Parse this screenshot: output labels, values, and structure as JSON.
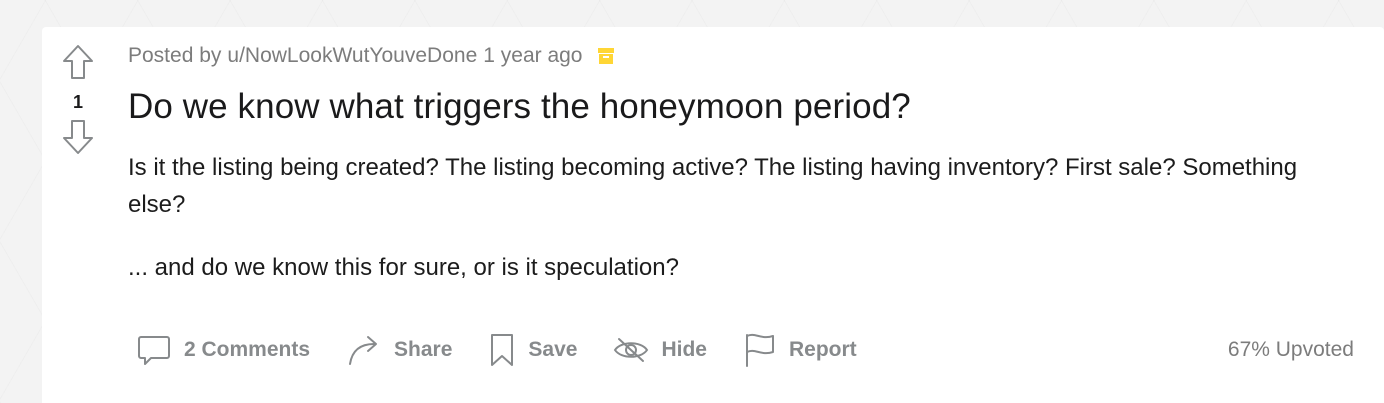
{
  "post": {
    "posted_by_prefix": "Posted by",
    "author": "u/NowLookWutYouveDone",
    "time": "1 year ago",
    "archive_icon": "archive-icon",
    "vote_count": "1",
    "title": "Do we know what triggers the honeymoon period?",
    "body": [
      "Is it the listing being created? The listing becoming active? The listing having inventory? First sale? Something else?",
      "... and do we know this for sure, or is it speculation?"
    ],
    "upvoted": "67% Upvoted"
  },
  "actions": {
    "comments_label": "2 Comments",
    "share_label": "Share",
    "save_label": "Save",
    "hide_label": "Hide",
    "report_label": "Report"
  },
  "icons": {
    "upvote": "upvote-arrow-icon",
    "downvote": "downvote-arrow-icon",
    "comments": "comment-bubble-icon",
    "share": "share-arrow-icon",
    "save": "bookmark-icon",
    "hide": "eye-slash-icon",
    "report": "flag-icon"
  },
  "colors": {
    "archive_accent": "#ffd635",
    "muted_text": "#878a8c",
    "title_text": "#1a1a1b"
  }
}
